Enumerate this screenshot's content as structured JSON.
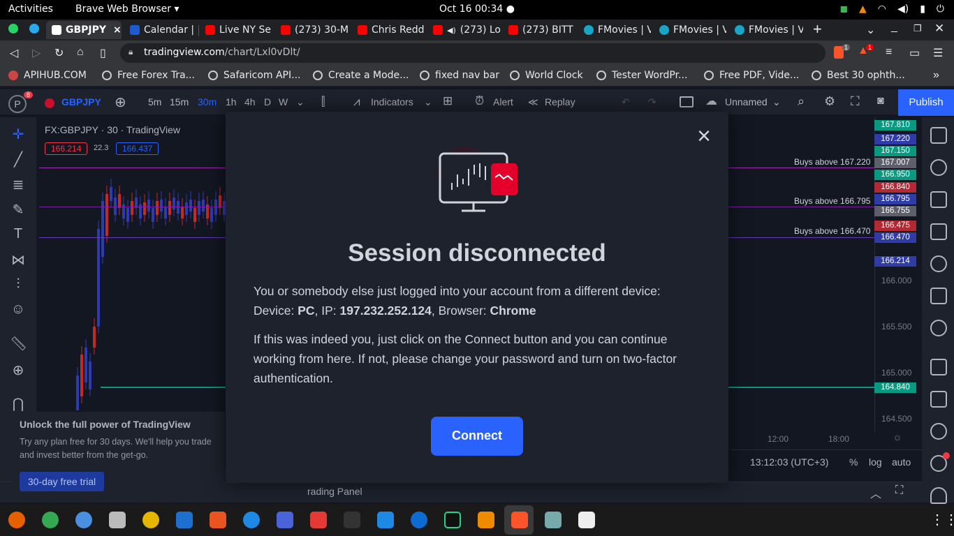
{
  "topbar": {
    "activities": "Activities",
    "app_menu": "Brave Web Browser ▾",
    "clock": "Oct 16  00:34  ●"
  },
  "tabs": [
    {
      "label": "GBPJPY",
      "close": "×"
    },
    {
      "label": "Calendar |"
    },
    {
      "label": "Live NY Se"
    },
    {
      "label": "(273) 30-M"
    },
    {
      "label": "Chris Redd"
    },
    {
      "label": "(273) Lo"
    },
    {
      "label": "(273) BITT"
    },
    {
      "label": "FMovies | V"
    },
    {
      "label": "FMovies | V"
    },
    {
      "label": "FMovies | V"
    }
  ],
  "new_tab": "+",
  "address": {
    "domain": "tradingview.com",
    "path": "/chart/Lxl0vDlt/",
    "shield_badge": "1",
    "rewards_badge": "1"
  },
  "bookmarks": [
    "APIHUB.COM",
    "Free Forex Tra...",
    "Safaricom API...",
    "Create a Mode...",
    "fixed nav bar",
    "World Clock",
    "Tester WordPr...",
    "Free PDF, Vide...",
    "Best 30 ophth..."
  ],
  "toolbar": {
    "avatar": "P",
    "notif": "8",
    "symbol": "GBPJPY",
    "intervals": [
      "5m",
      "15m",
      "30m",
      "1h",
      "4h",
      "D",
      "W"
    ],
    "indicators": "Indicators",
    "alert": "Alert",
    "replay": "Replay",
    "layout_name": "Unnamed",
    "publish": "Publish"
  },
  "legend": {
    "symbol": "FX:GBPJPY · 30 · TradingView",
    "bid": "166.214",
    "spread": "22.3",
    "ask": "166.437"
  },
  "price_labels": [
    {
      "v": "167.810",
      "c": "#089981"
    },
    {
      "v": "167.220",
      "c": "#2f3ca8"
    },
    {
      "v": "167.150",
      "c": "#089981"
    },
    {
      "v": "167.007",
      "c": "#5d606b"
    },
    {
      "v": "166.950",
      "c": "#089981"
    },
    {
      "v": "166.840",
      "c": "#b22833"
    },
    {
      "v": "166.795",
      "c": "#2f3ca8"
    },
    {
      "v": "166.755",
      "c": "#5d606b"
    },
    {
      "v": "166.475",
      "c": "#b22833"
    },
    {
      "v": "166.470",
      "c": "#2f3ca8"
    },
    {
      "v": "166.214",
      "c": "#2f3ca8"
    },
    {
      "v": "164.840",
      "c": "#089981"
    }
  ],
  "axis_ticks": [
    "166.000",
    "165.500",
    "165.000",
    "164.500"
  ],
  "lines": [
    {
      "text": "Buys above 167.220"
    },
    {
      "text": "Buys above 166.795"
    },
    {
      "text": "Buys above 166.470"
    }
  ],
  "time_axis": [
    "12:00",
    "18:00"
  ],
  "status": {
    "time": "13:12:03 (UTC+3)",
    "percent": "%",
    "log": "log",
    "auto": "auto"
  },
  "trading_panel": "rading Panel",
  "promo": {
    "title": "Unlock the full power of TradingView",
    "body": "Try any plan free for 30 days. We'll help you trade and invest better from the get-go.",
    "cta": "30-day free trial"
  },
  "dialog": {
    "title": "Session disconnected",
    "p1": "You or somebody else just logged into your account from a different device:",
    "device_label": "Device: ",
    "device": "PC",
    "ip_label": ", IP: ",
    "ip": "197.232.252.124",
    "browser_label": ", Browser: ",
    "browser": "Chrome",
    "p2": "If this was indeed you, just click on the Connect button and you can continue working from here. If not, please change your password and turn on two-factor authentication.",
    "connect": "Connect"
  }
}
